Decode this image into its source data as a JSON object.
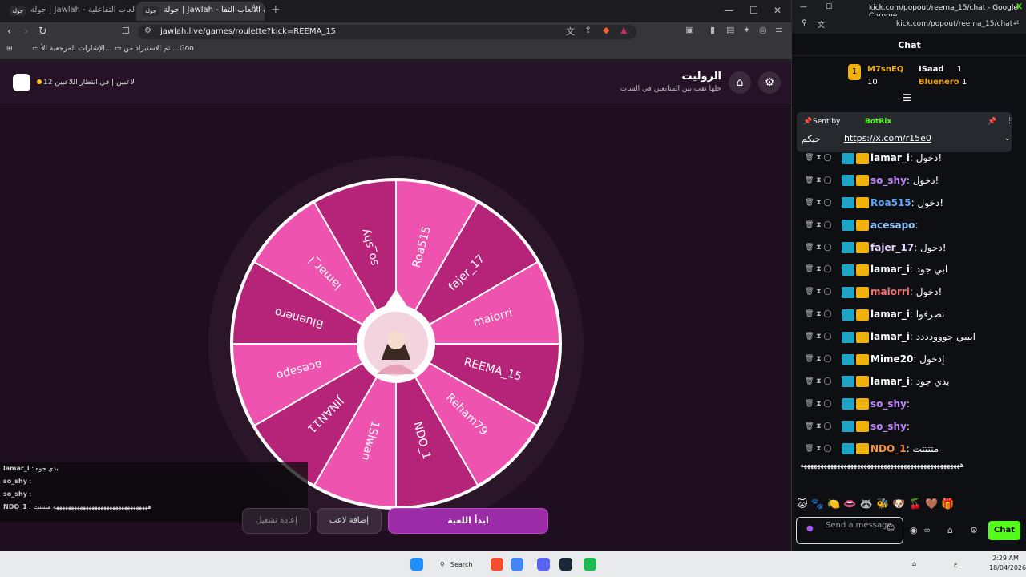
{
  "browser": {
    "tabs": [
      {
        "label": "جولة | Jawlah - منصة الألعاب التفاعلية",
        "active": false
      },
      {
        "label": "جولة | Jawlah - منصة الألعاب التفا",
        "active": true
      }
    ],
    "tab_favicon": "جولة",
    "url": "jawlah.live/games/roulette?kick=REEMA_15",
    "bookmarks": [
      "تم الاستيراد من ...Goo",
      "الإشارات المرجعية الأ..."
    ]
  },
  "game": {
    "title": "الروليت",
    "subtitle": "خلها تقب بين المتابعين في الشات",
    "players_count": "12 لاعبين",
    "status": "في انتظار اللاعبين",
    "wheel_segments": [
      "Roa515",
      "fajer_17",
      "maiorri",
      "REEMA_15",
      "Reham79",
      "NDO_1",
      "1Slwan",
      "JINAN11",
      "acesapo",
      "Bluenero",
      "lamar_i",
      "so_shy"
    ],
    "colors": {
      "light": "#ee53b0",
      "dark": "#b52478",
      "rim": "#2a1529"
    },
    "buttons": {
      "start": "ابدأ اللعبة",
      "add": "إضافة لاعب",
      "reset": "إعادة تشغيل"
    },
    "overlay_chat": [
      {
        "name": "lamar_i",
        "text": ": بدي جوه"
      },
      {
        "name": "so_shy",
        "text": ":"
      },
      {
        "name": "so_shy",
        "text": ":"
      },
      {
        "name": "NDO_1",
        "text": ": ههههههههههههههههههههههههههههههههه متتتتت"
      }
    ]
  },
  "chat": {
    "window_title": "kick.com/popout/reema_15/chat - Google Chrome",
    "address": "kick.com/popout/reema_15/chat",
    "header": "Chat",
    "leaderboard": {
      "first": {
        "rank": "1",
        "name": "M7snEQ",
        "value": "10"
      },
      "second": {
        "name": "ISaad",
        "value": "1"
      },
      "third": {
        "name": "Bluenero",
        "value": "1"
      }
    },
    "pinned": {
      "sent_by": "Sent by",
      "bot": "BotRix",
      "text": "حيكم",
      "link": "https://x.com/r15e0"
    },
    "messages": [
      {
        "name": "lamar_i",
        "color": "#ffffff",
        "text": "دخول!"
      },
      {
        "name": "so_shy",
        "color": "#c084fc",
        "text": "دخول!"
      },
      {
        "name": "Roa515",
        "color": "#60a5fa",
        "text": "دخول!"
      },
      {
        "name": "acesapo",
        "color": "#93c5fd",
        "text": ""
      },
      {
        "name": "fajer_17",
        "color": "#e9d5ff",
        "text": "دخول!"
      },
      {
        "name": "lamar_i",
        "color": "#ffffff",
        "text": "ابي جود"
      },
      {
        "name": "maiorri",
        "color": "#f87171",
        "text": "دخول!"
      },
      {
        "name": "lamar_i",
        "color": "#ffffff",
        "text": "تصرفوا"
      },
      {
        "name": "lamar_i",
        "color": "#ffffff",
        "text": "ابيبي جووودددد"
      },
      {
        "name": "Mime20",
        "color": "#ffffff",
        "text": "إدخول"
      },
      {
        "name": "lamar_i",
        "color": "#ffffff",
        "text": "بدي جود"
      },
      {
        "name": "so_shy",
        "color": "#c084fc",
        "text": ""
      },
      {
        "name": "so_shy",
        "color": "#c084fc",
        "text": ""
      },
      {
        "name": "NDO_1",
        "color": "#fb923c",
        "text": "متتتتت"
      }
    ],
    "long_text": "ههههههههههههههههههههههههههههههههههههههههههههههههه",
    "input_placeholder": "Send a message",
    "send_button": "Chat"
  },
  "taskbar": {
    "search": "Search",
    "time": "2:29 AM",
    "date": "18/04/2026"
  }
}
